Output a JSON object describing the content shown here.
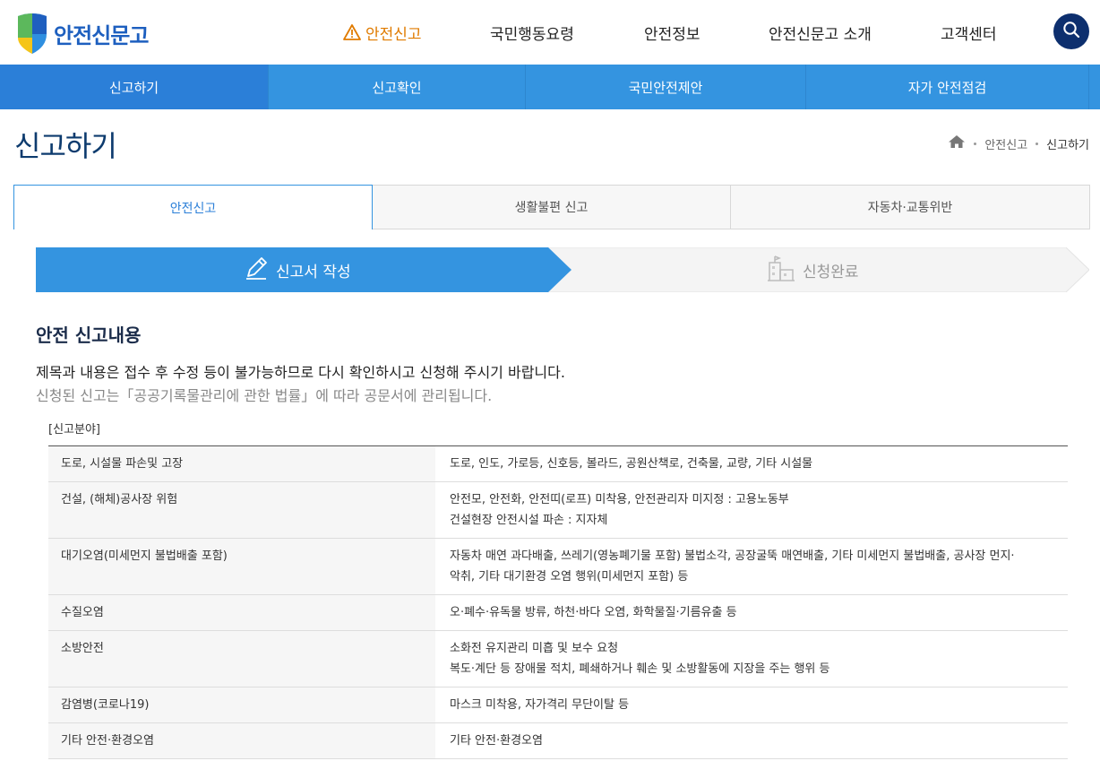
{
  "header": {
    "logo_text": "안전신문고",
    "nav": [
      {
        "label": "안전신고",
        "active": true
      },
      {
        "label": "국민행동요령",
        "active": false
      },
      {
        "label": "안전정보",
        "active": false
      },
      {
        "label": "안전신문고 소개",
        "active": false
      },
      {
        "label": "고객센터",
        "active": false
      }
    ],
    "search_icon": "search-icon"
  },
  "subnav": {
    "items": [
      {
        "label": "신고하기",
        "active": true
      },
      {
        "label": "신고확인",
        "active": false
      },
      {
        "label": "국민안전제안",
        "active": false
      },
      {
        "label": "자가 안전점검",
        "active": false
      }
    ]
  },
  "page": {
    "title": "신고하기",
    "breadcrumb": [
      "안전신고",
      "신고하기"
    ]
  },
  "tabs": [
    {
      "label": "안전신고",
      "active": true
    },
    {
      "label": "생활불편 신고",
      "active": false
    },
    {
      "label": "자동차·교통위반",
      "active": false
    }
  ],
  "steps": [
    {
      "label": "신고서 작성",
      "icon": "pencil-icon",
      "active": true
    },
    {
      "label": "신청완료",
      "icon": "building-icon",
      "active": false
    }
  ],
  "content": {
    "section_title": "안전 신고내용",
    "notice_primary": "제목과 내용은 접수 후 수정 등이 불가능하므로 다시 확인하시고 신청해 주시기 바랍니다.",
    "notice_secondary": "신청된 신고는「공공기록물관리에 관한 법률」에 따라 공문서에 관리됩니다.",
    "table_caption": "[신고분야]",
    "fields": [
      {
        "category": "도로, 시설물 파손및 고장",
        "desc": [
          "도로, 인도, 가로등, 신호등, 볼라드, 공원산책로, 건축물, 교량, 기타 시설물"
        ]
      },
      {
        "category": "건설, (해체)공사장 위험",
        "desc": [
          "안전모, 안전화, 안전띠(로프) 미착용, 안전관리자 미지정 : 고용노동부",
          "건설현장 안전시설 파손 : 지자체"
        ]
      },
      {
        "category": "대기오염(미세먼지 불법배출 포함)",
        "desc": [
          "자동차 매연 과다배출, 쓰레기(영농폐기물 포함) 불법소각, 공장굴뚝 매연배출, 기타 미세먼지 불법배출, 공사장 먼지·",
          "악취, 기타 대기환경 오염 행위(미세먼지 포함) 등"
        ]
      },
      {
        "category": "수질오염",
        "desc": [
          "오·폐수·유독물 방류, 하천·바다 오염, 화학물질·기름유출 등"
        ]
      },
      {
        "category": "소방안전",
        "desc": [
          "소화전 유지관리 미흡 및 보수 요청",
          "복도·계단 등 장애물 적치, 폐쇄하거나 훼손 및 소방활동에 지장을 주는 행위 등"
        ]
      },
      {
        "category": "감염병(코로나19)",
        "desc": [
          "마스크 미착용, 자가격리 무단이탈 등"
        ]
      },
      {
        "category": "기타 안전·환경오염",
        "desc": [
          "기타 안전·환경오염"
        ]
      }
    ]
  },
  "colors": {
    "brand_blue": "#3494e0",
    "active_blue": "#2b7fd8",
    "navy": "#0d2f6e",
    "warning_orange": "#e07b00"
  }
}
